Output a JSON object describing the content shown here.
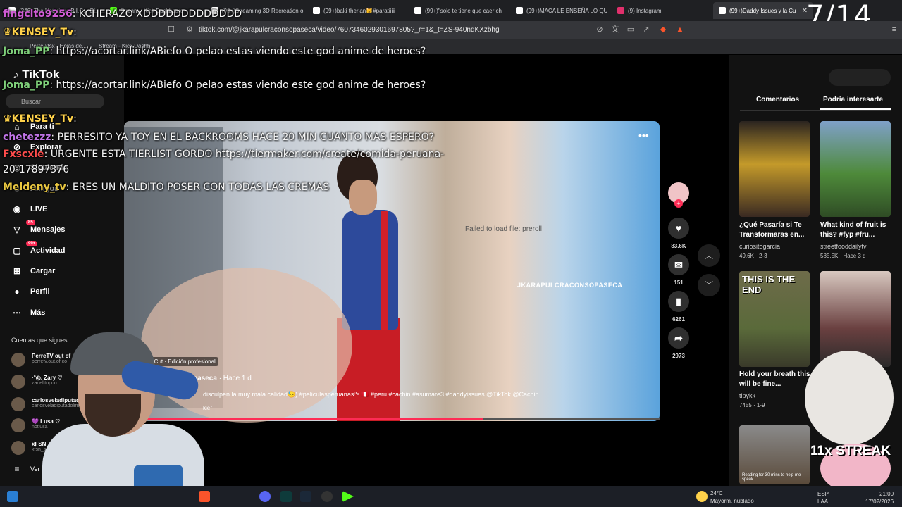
{
  "browser": {
    "tabs": [
      {
        "label": "(346) The Notorious B.I.G. - Bi"
      },
      {
        "label": "Stream - Kick Dashboard"
      },
      {
        "label": "(99+)Streaming 3D Recreation o"
      },
      {
        "label": "(99+)baki therian🐱#paratiiiii"
      },
      {
        "label": "(99+)\"solo te tiene que caer ch"
      },
      {
        "label": "(99+)MACA LE ENSEÑA LO QU"
      },
      {
        "label": "(9) Instagram"
      },
      {
        "label": "(99+)Daddy Issues y la Cu"
      }
    ],
    "url": "tiktok.com/@jkarapulcraconsopaseca/video/7607346029301697805?_r=1&_t=ZS-940ndKXzbhg",
    "bookmarks": [
      "Perre.xlsx - Hojas de...",
      "Stream - Kick Dashb..."
    ]
  },
  "counter": "7/14",
  "tiktok": {
    "logo": "TikTok",
    "search_placeholder": "Buscar",
    "nav": [
      {
        "label": "Para ti",
        "icon": "home-icon"
      },
      {
        "label": "Explorar",
        "icon": "compass-icon"
      },
      {
        "label": "Siguiendo",
        "icon": "following-icon"
      },
      {
        "label": "Amigos",
        "icon": "friends-icon"
      },
      {
        "label": "LIVE",
        "icon": "live-icon"
      },
      {
        "label": "Mensajes",
        "icon": "messages-icon",
        "badge": "85"
      },
      {
        "label": "Actividad",
        "icon": "activity-icon",
        "badge": "99+"
      },
      {
        "label": "Cargar",
        "icon": "upload-icon"
      },
      {
        "label": "Perfil",
        "icon": "profile-icon"
      },
      {
        "label": "Más",
        "icon": "more-icon"
      }
    ],
    "following_title": "Cuentas que sigues",
    "following": [
      {
        "name": "PerreTV out of",
        "handle": "perretv.out.of.co"
      },
      {
        "name": "·°◎. Zary ♡",
        "handle": "zarielitopou"
      },
      {
        "name": "carlosveladiputado",
        "handle": "carlosveladiputadolima"
      },
      {
        "name": "💜 Lusa ♡",
        "handle": "notlusa"
      },
      {
        "name": "xFSN_S",
        "handle": "xfsn_s"
      }
    ],
    "see_more": "Ver"
  },
  "video": {
    "watermark": "JKARAPULCRACONSOPASECA",
    "failed_text": "Failed to load file: preroll",
    "capcut_label": "CapCut · Edición profesional",
    "author": "paseca",
    "time": "· Hace 1 d",
    "caption": "disculpen la muy mala calidad😓) #peliculasperuanasᴾᴱ 🇵🇪 #peru #cachin #asumare3 #daddyissues @TikTok @Cachin ...",
    "music": "kie⁷",
    "progress": 0.67
  },
  "actions": {
    "likes": "83.6K",
    "comments": "151",
    "saves": "6261",
    "shares": "2973"
  },
  "right_panel": {
    "tab_comments": "Comentarios",
    "tab_interest": "Podría interesarte",
    "items": [
      {
        "title": "¿Qué Pasaría si Te Transformaras en...",
        "author": "curiositogarcia",
        "stats": "49.6K · 2-3"
      },
      {
        "title": "What kind of fruit is this? #fyp #fru...",
        "author": "streetfooddailytv",
        "stats": "585.5K · Hace 3 d"
      },
      {
        "title": "Hold your breath this will be fine...",
        "author": "tipykk",
        "stats": "7455 · 1-9"
      },
      {
        "title": "",
        "author": "",
        "stats": ""
      }
    ],
    "thumb_text": "THIS IS THE END",
    "thumb_subtext": "Reading for 30 mins to help me speak..."
  },
  "chat": [
    {
      "user": "fingcito9256",
      "text": ": KCHERAZO XDDDDDDDDDDDDD",
      "color": "#d05bd5"
    },
    {
      "user": "KENSEY_Tv",
      "text": ":",
      "color": "#ffd24a"
    },
    {
      "user": "Joma_PP",
      "text": ": https://acortar.link/ABiefo O pelao estas viendo este god anime de heroes?",
      "color": "#7fd07a"
    },
    {
      "user": "Joma_PP",
      "text": ": https://acortar.link/ABiefo O pelao estas viendo este god anime de heroes?",
      "color": "#7fd07a"
    },
    {
      "user": "KENSEY_Tv",
      "text": ":",
      "color": "#ffd24a"
    },
    {
      "user": "chetezzz",
      "text": ": PERRESITO YA TOY EN EL BACKROOMS HACE 20 MIN CUANTO MAS ESPERO?",
      "color": "#c074e6"
    },
    {
      "user": "Fxscxie",
      "text": ": URGENTE ESTA TIERLIST GORDO https://tiermaker.com/create/comida-peruana-",
      "color": "#ff4d4d"
    },
    {
      "user": "",
      "text": "20-17897376",
      "color": "#ffffff"
    },
    {
      "user": "Meldeny_tv",
      "text": ": ERES UN MALDITO POSER CON TODAS LAS CREMAS",
      "color": "#e8c640"
    }
  ],
  "overlay_streak": "11x STREAK",
  "taskbar": {
    "weather_temp": "24°C",
    "weather_desc": "Mayorm. nublado",
    "lang": "ESP",
    "lang_sub": "LAA",
    "time": "21:00",
    "date": "17/02/2026"
  }
}
